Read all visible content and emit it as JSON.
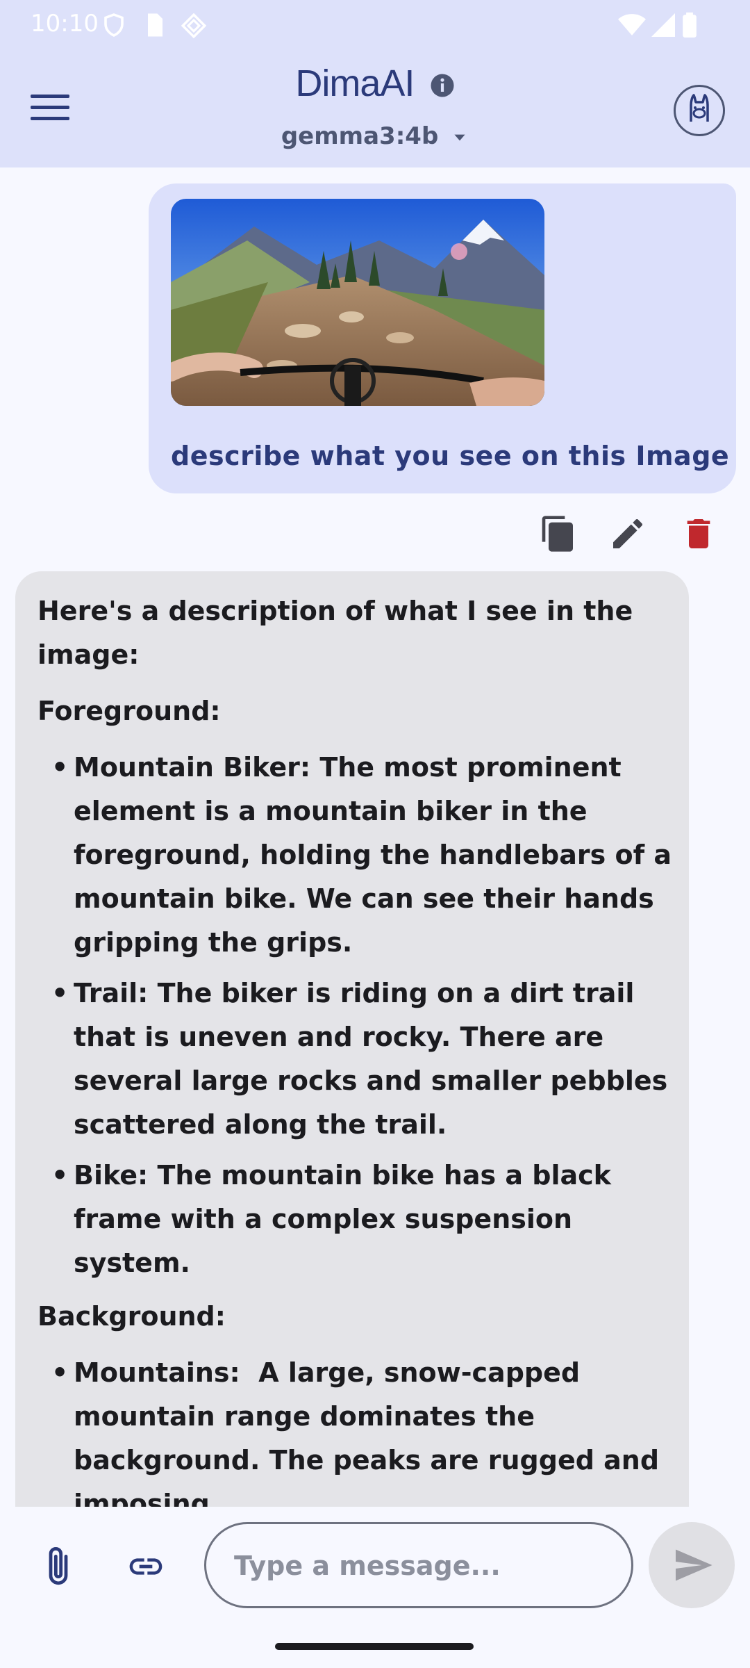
{
  "status_bar": {
    "time": "10:10"
  },
  "header": {
    "app_title": "DimaAI",
    "model_selector": "gemma3:4b",
    "icons": [
      "menu-icon",
      "info-icon",
      "chevron-down-icon",
      "llama-avatar-icon"
    ]
  },
  "user_message": {
    "text": "describe what you see on this Image",
    "attachment": "image"
  },
  "message_actions": [
    "copy-icon",
    "edit-icon",
    "delete-icon"
  ],
  "ai_message": {
    "intro": "Here's a description of what I see in the image:",
    "sections": [
      {
        "heading": "Foreground:",
        "items": [
          {
            "label": "Mountain Biker:",
            "text": " The most prominent element is a mountain biker in the foreground, holding the handlebars of a mountain bike. We can see their hands gripping the grips."
          },
          {
            "label": "Trail:",
            "text": " The biker is riding on a dirt trail that is uneven and rocky. There are several large rocks and smaller pebbles scattered along the trail."
          },
          {
            "label": "Bike:",
            "text": " The mountain bike has a black frame with a complex suspension system."
          }
        ]
      },
      {
        "heading": "Background:",
        "items": [
          {
            "label": "Mountains:",
            "text": "  A large, snow-capped mountain range dominates the background. The peaks are rugged and imposing."
          }
        ]
      }
    ]
  },
  "composer": {
    "placeholder": "Type a message..."
  },
  "colors": {
    "header_bg": "#dde1fa",
    "accent": "#2b3a7a",
    "user_bubble": "#dce0fb",
    "ai_bubble": "#e4e4e8",
    "delete": "#c0282d"
  }
}
